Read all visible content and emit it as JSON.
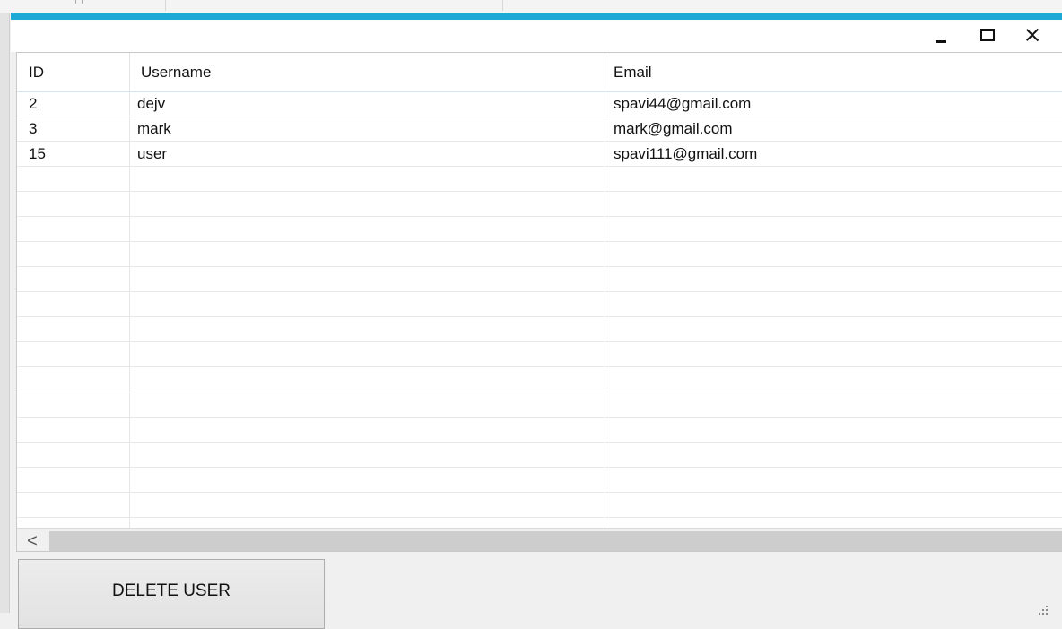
{
  "window": {
    "accent_color": "#1ca9d6",
    "controls": [
      {
        "name": "minimize-icon"
      },
      {
        "name": "maximize-icon"
      },
      {
        "name": "close-icon"
      }
    ]
  },
  "table": {
    "columns": [
      "ID",
      "Username",
      "Email"
    ],
    "rows": [
      {
        "id": "2",
        "username": "dejv",
        "email": "spavi44@gmail.com"
      },
      {
        "id": "3",
        "username": "mark",
        "email": "mark@gmail.com"
      },
      {
        "id": "15",
        "username": "user",
        "email": "spavi111@gmail.com"
      }
    ],
    "scroll_left_glyph": "<"
  },
  "actions": {
    "delete_label": "DELETE USER"
  }
}
